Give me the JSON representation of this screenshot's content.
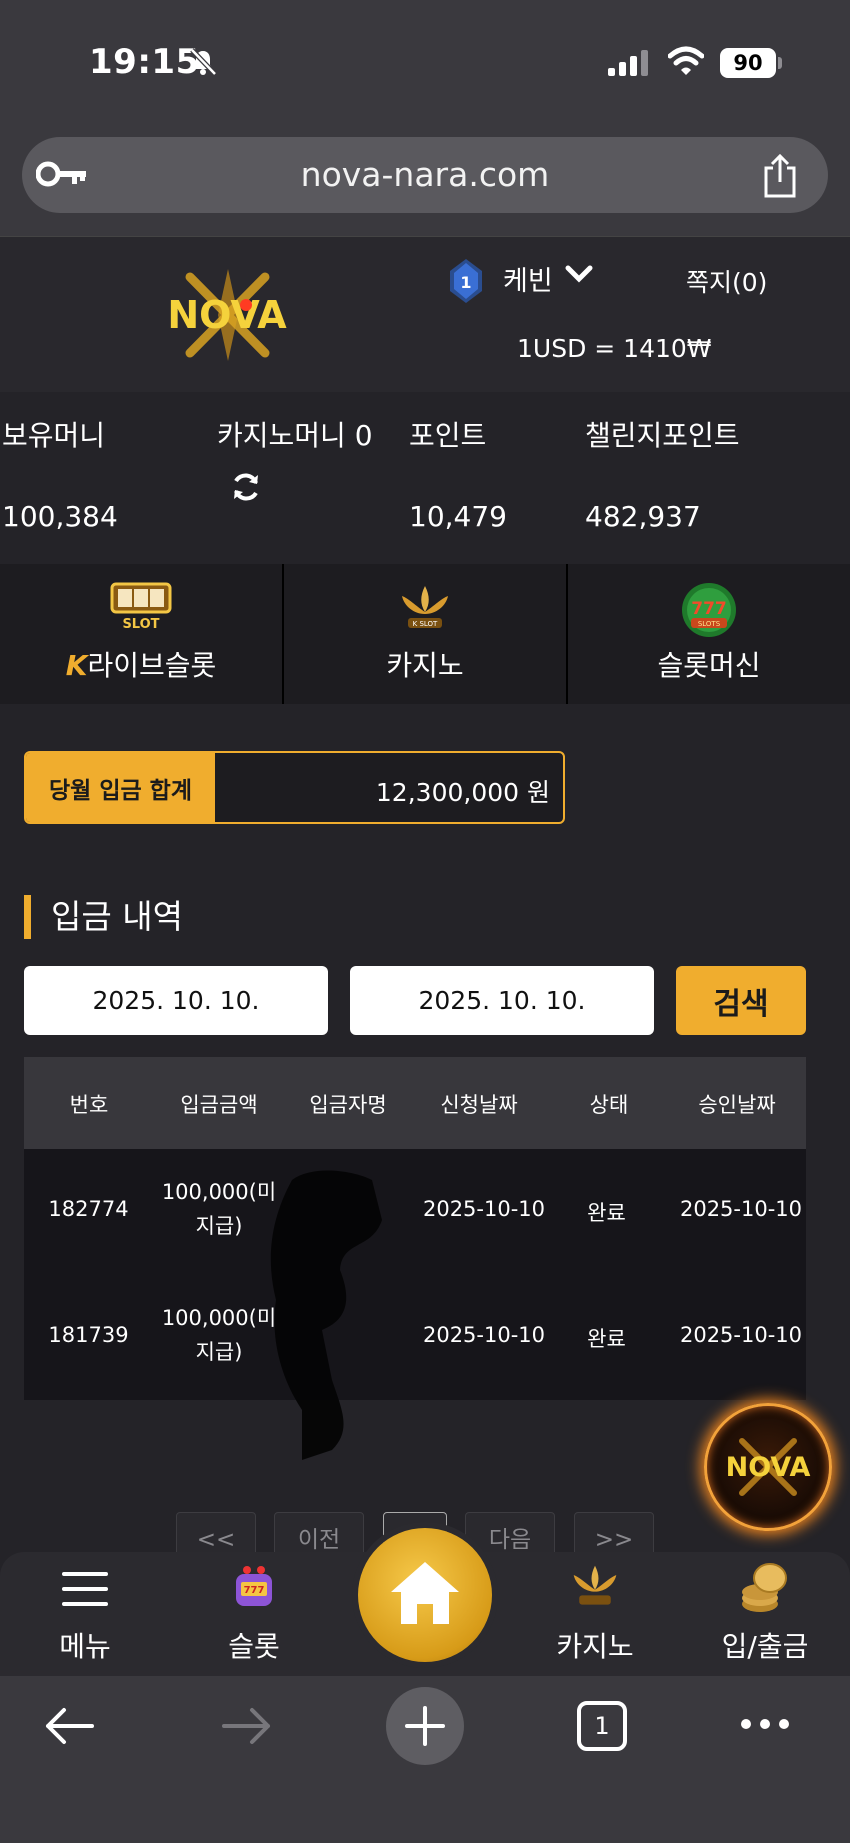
{
  "status_bar": {
    "time": "19:15",
    "battery": "90"
  },
  "browser": {
    "url": "nova-nara.com",
    "tab_count": "1"
  },
  "header": {
    "logo_text": "NOVA",
    "level": "1",
    "user_name": "케빈",
    "messages": "쪽지(0)",
    "exchange_rate": "1USD = 1410₩"
  },
  "balances": {
    "money_label": "보유머니",
    "money_value": "100,384",
    "casino_money_label": "카지노머니 0",
    "points_label": "포인트",
    "points_value": "10,479",
    "challenge_label": "챌린지포인트",
    "challenge_value": "482,937"
  },
  "categories": [
    {
      "label": "라이브슬롯",
      "prefix": "K",
      "badge": "LIVE SLOT"
    },
    {
      "label": "카지노",
      "badge": "K SLOT"
    },
    {
      "label": "슬롯머신",
      "badge": "777 SLOTS"
    }
  ],
  "monthly_total": {
    "label": "당월 입금 합계",
    "value": "12,300,000 원"
  },
  "section_title": "입금 내역",
  "search": {
    "date_from": "2025. 10. 10.",
    "date_to": "2025. 10. 10.",
    "button": "검색"
  },
  "table": {
    "headers": [
      "번호",
      "입금금액",
      "입금자명",
      "신청날짜",
      "상태",
      "승인날짜"
    ],
    "rows": [
      {
        "id": "182774",
        "amount_1": "100,000(미",
        "amount_2": "지급)",
        "name": "",
        "request_date": "2025-10-10",
        "status": "완료",
        "approve_date": "2025-10-10"
      },
      {
        "id": "181739",
        "amount_1": "100,000(미",
        "amount_2": "지급)",
        "name": "",
        "request_date": "2025-10-10",
        "status": "완료",
        "approve_date": "2025-10-10"
      }
    ]
  },
  "pager": {
    "first": "<<",
    "prev": "이전",
    "next": "다음",
    "last": ">>"
  },
  "bottom_nav": {
    "menu": "메뉴",
    "slot": "슬롯",
    "casino": "카지노",
    "deposit": "입/출금"
  },
  "colors": {
    "accent": "#f0ad2e",
    "background": "#242328",
    "header": "#29282d"
  }
}
